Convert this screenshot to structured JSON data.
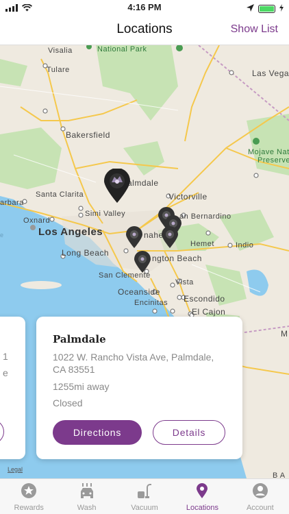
{
  "status": {
    "time": "4:16 PM"
  },
  "nav": {
    "title": "Locations",
    "show_list": "Show List"
  },
  "map": {
    "labels": {
      "visalia": "Visalia",
      "national_park": "National Park",
      "tulare": "Tulare",
      "las_vegas": "Las Vega",
      "bakersfield": "Bakersfield",
      "mojave": "Mojave Natio",
      "preserve": "Preserve",
      "palmdale": "almdale",
      "victorville": "Victorville",
      "santa_clarita": "Santa Clarita",
      "barbara": "arbara",
      "simi_valley": "Simi Valley",
      "san_bernardino": "an Bernardino",
      "oxnard": "Oxnard",
      "los_angeles": "Los Angeles",
      "anaheim": "naheim",
      "hemet": "Hemet",
      "indio": "Indio",
      "long_beach": "Long Beach",
      "huntington_beach": "ngton Beach",
      "san_clemente": "San Clemente",
      "vista": "Vista",
      "oceanside": "Oceanside",
      "escondido": "Escondido",
      "encinitas": "Encinitas",
      "el_cajon": "El Cajon",
      "edge_m": "M",
      "edge_ba": "B A",
      "edge_e": "e"
    },
    "legal": "Legal"
  },
  "card": {
    "name": "Palmdale",
    "address": "1022 W. Rancho Vista Ave, Palmdale, CA 83551",
    "distance": "1255mi away",
    "status": "Closed",
    "directions_label": "Directions",
    "details_label": "Details"
  },
  "prev_card": {
    "line1": "1",
    "line2": "e"
  },
  "tabs": [
    {
      "label": "Rewards",
      "icon": "star-badge-icon",
      "active": false
    },
    {
      "label": "Wash",
      "icon": "car-wash-icon",
      "active": false
    },
    {
      "label": "Vacuum",
      "icon": "vacuum-icon",
      "active": false
    },
    {
      "label": "Locations",
      "icon": "location-pin-icon",
      "active": true
    },
    {
      "label": "Account",
      "icon": "account-icon",
      "active": false
    }
  ],
  "colors": {
    "accent": "#7c3a8c",
    "water": "#8ecbee",
    "park": "#c7e3b4",
    "road": "#f5c84c"
  }
}
